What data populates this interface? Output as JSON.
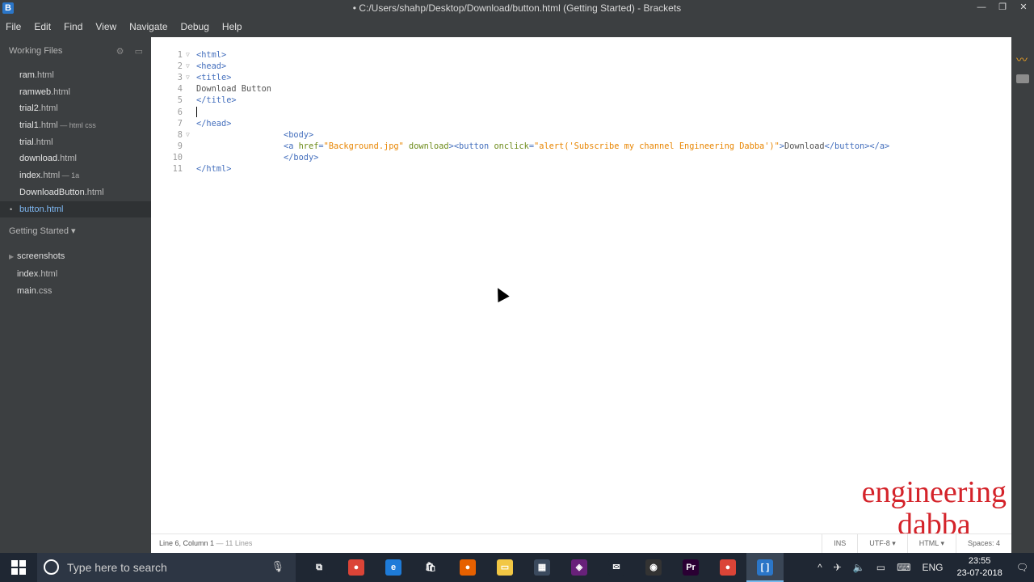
{
  "window": {
    "app_icon": "B",
    "title": "• C:/Users/shahp/Desktop/Download/button.html (Getting Started) - Brackets",
    "controls": [
      "—",
      "❐",
      "✕"
    ]
  },
  "menu": [
    "File",
    "Edit",
    "Find",
    "View",
    "Navigate",
    "Debug",
    "Help"
  ],
  "sidebar": {
    "working_files_label": "Working Files",
    "working_files": [
      {
        "name": "ram",
        "ext": ".html",
        "note": ""
      },
      {
        "name": "ramweb",
        "ext": ".html",
        "note": ""
      },
      {
        "name": "trial2",
        "ext": ".html",
        "note": ""
      },
      {
        "name": "trial1",
        "ext": ".html",
        "note": " — html css"
      },
      {
        "name": "trial",
        "ext": ".html",
        "note": ""
      },
      {
        "name": "download",
        "ext": ".html",
        "note": ""
      },
      {
        "name": "index",
        "ext": ".html",
        "note": " — 1a"
      },
      {
        "name": "DownloadButton",
        "ext": ".html",
        "note": ""
      },
      {
        "name": "button",
        "ext": ".html",
        "note": "",
        "active": true,
        "unsaved_dot": "•"
      }
    ],
    "project_label": "Getting Started ▾",
    "project_items": [
      {
        "name": "screenshots",
        "ext": "",
        "folder": true,
        "arrow": "▶"
      },
      {
        "name": "index",
        "ext": ".html",
        "folder": false
      },
      {
        "name": "main",
        "ext": ".css",
        "folder": false
      }
    ]
  },
  "editor": {
    "fold_glyph": "▽",
    "lines": [
      {
        "n": "1",
        "fold": true,
        "indent": 0,
        "tokens": [
          {
            "t": "tag",
            "v": "<html>"
          }
        ]
      },
      {
        "n": "2",
        "fold": true,
        "indent": 0,
        "tokens": [
          {
            "t": "tag",
            "v": "<head>"
          }
        ]
      },
      {
        "n": "3",
        "fold": true,
        "indent": 0,
        "tokens": [
          {
            "t": "tag",
            "v": "<title>"
          }
        ]
      },
      {
        "n": "4",
        "fold": false,
        "indent": 0,
        "tokens": [
          {
            "t": "txt",
            "v": "Download Button"
          }
        ]
      },
      {
        "n": "5",
        "fold": false,
        "indent": 0,
        "tokens": [
          {
            "t": "tag",
            "v": "</title>"
          }
        ]
      },
      {
        "n": "6",
        "fold": false,
        "indent": 0,
        "tokens": [],
        "cursor": true
      },
      {
        "n": "7",
        "fold": false,
        "indent": 0,
        "tokens": [
          {
            "t": "tag",
            "v": "</head>"
          }
        ]
      },
      {
        "n": "8",
        "fold": true,
        "indent": 1,
        "tokens": [
          {
            "t": "tag",
            "v": "<body>"
          }
        ]
      },
      {
        "n": "9",
        "fold": false,
        "indent": 1,
        "tokens": [
          {
            "t": "tag",
            "v": "<a "
          },
          {
            "t": "attr",
            "v": "href"
          },
          {
            "t": "tag",
            "v": "="
          },
          {
            "t": "str",
            "v": "\"Background.jpg\""
          },
          {
            "t": "tag",
            "v": " "
          },
          {
            "t": "attr",
            "v": "download"
          },
          {
            "t": "tag",
            "v": "><button "
          },
          {
            "t": "attr",
            "v": "onclick"
          },
          {
            "t": "tag",
            "v": "="
          },
          {
            "t": "str",
            "v": "\"alert('Subscribe my channel Engineering Dabba')\""
          },
          {
            "t": "tag",
            "v": ">"
          },
          {
            "t": "txt",
            "v": "Download"
          },
          {
            "t": "tag",
            "v": "</button></a>"
          }
        ]
      },
      {
        "n": "10",
        "fold": false,
        "indent": 1,
        "tokens": [
          {
            "t": "tag",
            "v": "</body>"
          }
        ]
      },
      {
        "n": "11",
        "fold": false,
        "indent": 0,
        "tokens": [
          {
            "t": "tag",
            "v": "</html>"
          }
        ]
      }
    ],
    "watermark_line1": "engineering",
    "watermark_line2": "dabba"
  },
  "statusbar": {
    "position": "Line 6, Column 1",
    "lines": " — 11 Lines",
    "mode": "INS",
    "encoding": "UTF-8 ▾",
    "language": "HTML ▾",
    "spaces": "Spaces: 4"
  },
  "taskbar": {
    "search_placeholder": "Type here to search",
    "apps": [
      {
        "name": "task-view-icon",
        "glyph": "⧉",
        "color": "#1f2733"
      },
      {
        "name": "chrome-icon",
        "glyph": "●",
        "color": "#db4437"
      },
      {
        "name": "edge-icon",
        "glyph": "e",
        "color": "#1e7bd8"
      },
      {
        "name": "store-icon",
        "glyph": "🛍",
        "color": "#1f2733"
      },
      {
        "name": "firefox-icon",
        "glyph": "●",
        "color": "#e66000"
      },
      {
        "name": "file-explorer-icon",
        "glyph": "▭",
        "color": "#f2c744"
      },
      {
        "name": "mysql-workbench-icon",
        "glyph": "▦",
        "color": "#3b4a5e"
      },
      {
        "name": "visual-studio-icon",
        "glyph": "◈",
        "color": "#68217a"
      },
      {
        "name": "mail-icon",
        "glyph": "✉",
        "color": "#1f2733"
      },
      {
        "name": "obs-icon",
        "glyph": "◉",
        "color": "#333"
      },
      {
        "name": "premiere-icon",
        "glyph": "Pr",
        "color": "#2a0033"
      },
      {
        "name": "chrome-icon-2",
        "glyph": "●",
        "color": "#db4437"
      },
      {
        "name": "brackets-icon",
        "glyph": "[ ]",
        "color": "#2b76c8",
        "active": true
      }
    ],
    "tray": [
      "^",
      "✈",
      "🔈",
      "▭",
      "⌨"
    ],
    "lang": "ENG",
    "time": "23:55",
    "date": "23-07-2018",
    "notif": "🗨"
  }
}
